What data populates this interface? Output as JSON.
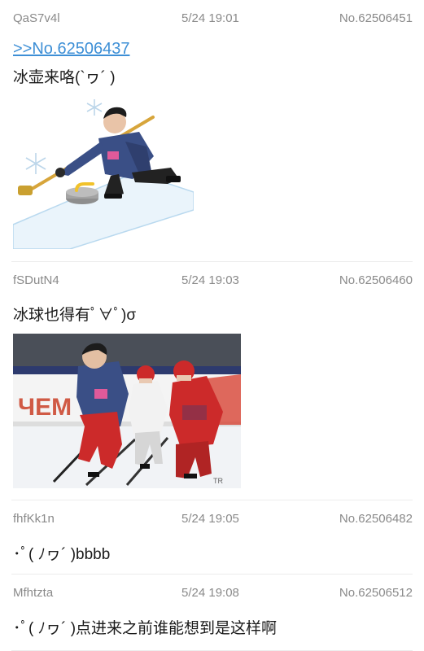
{
  "posts": [
    {
      "uid": "QaS7v4l",
      "time": "5/24 19:01",
      "no": "No.62506451",
      "quote": ">>No.62506437",
      "text": "冰壶来咯(`ヮ´ )",
      "image_subject": "curling-player"
    },
    {
      "uid": "fSDutN4",
      "time": "5/24 19:03",
      "no": "No.62506460",
      "text": "冰球也得有ﾟ∀ﾟ)σ",
      "image_subject": "ice-hockey-players",
      "image_rink_text": "ЧЕМ",
      "image_watermark": "TR"
    },
    {
      "uid": "fhfKk1n",
      "time": "5/24 19:05",
      "no": "No.62506482",
      "text": "･ﾟ( ﾉヮ´ )bbbb"
    },
    {
      "uid": "Mfhtzta",
      "time": "5/24 19:08",
      "no": "No.62506512",
      "text": "･ﾟ( ﾉヮ´ )点进来之前谁能想到是这样啊"
    }
  ],
  "colors": {
    "meta_text": "#8a8a8a",
    "quote_link": "#3d8fd6",
    "divider": "#ececec",
    "jersey_red": "#cc2a2a",
    "jersey_navy": "#3a4f86"
  }
}
